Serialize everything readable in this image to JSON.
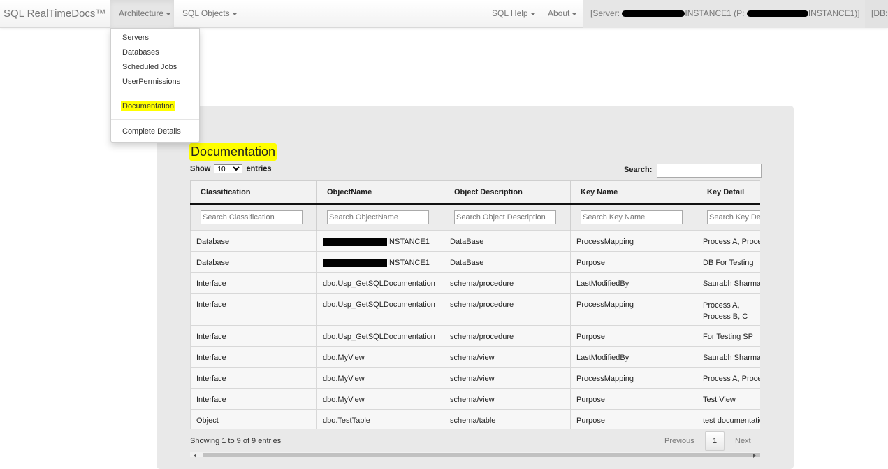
{
  "navbar": {
    "brand": "SQL RealTimeDocs™",
    "architecture": "Architecture",
    "sql_objects": "SQL Objects",
    "sql_help": "SQL Help",
    "about": "About",
    "server_prefix": "[Server: ",
    "server_instance": "INSTANCE1 (P: ",
    "server_instance_2": "INSTANCE1)]",
    "db_label": "[DB:"
  },
  "dropdown": {
    "items": [
      "Servers",
      "Databases",
      "Scheduled Jobs",
      "UserPermissions"
    ],
    "documentation": "Documentation",
    "complete_details": "Complete Details"
  },
  "page": {
    "title": "Documentation",
    "show": "Show",
    "entries_value": "10",
    "entries": "entries",
    "search_label": "Search:"
  },
  "table": {
    "headers": [
      "Classification",
      "ObjectName",
      "Object Description",
      "Key Name",
      "Key Detail"
    ],
    "filters": [
      "Search Classification",
      "Search ObjectName",
      "Search Object Description",
      "Search Key Name",
      "Search Key Detail"
    ],
    "rows": [
      [
        "Database",
        "INSTANCE1",
        "DataBase",
        "ProcessMapping",
        "Process A, Process B"
      ],
      [
        "Database",
        "INSTANCE1",
        "DataBase",
        "Purpose",
        "DB For Testing"
      ],
      [
        "Interface",
        "dbo.Usp_GetSQLDocumentation",
        "schema/procedure",
        "LastModifiedBy",
        "Saurabh Sharma"
      ],
      [
        "Interface",
        "dbo.Usp_GetSQLDocumentation",
        "schema/procedure",
        "ProcessMapping",
        "Process A, Process B, C"
      ],
      [
        "Interface",
        "dbo.Usp_GetSQLDocumentation",
        "schema/procedure",
        "Purpose",
        "For Testing SP"
      ],
      [
        "Interface",
        "dbo.MyView",
        "schema/view",
        "LastModifiedBy",
        "Saurabh Sharma"
      ],
      [
        "Interface",
        "dbo.MyView",
        "schema/view",
        "ProcessMapping",
        "Process A, Process B"
      ],
      [
        "Interface",
        "dbo.MyView",
        "schema/view",
        "Purpose",
        "Test View"
      ],
      [
        "Object",
        "dbo.TestTable",
        "schema/table",
        "Purpose",
        "test documentation"
      ]
    ]
  },
  "footer": {
    "info": "Showing 1 to 9 of 9 entries",
    "previous": "Previous",
    "page": "1",
    "next": "Next"
  }
}
